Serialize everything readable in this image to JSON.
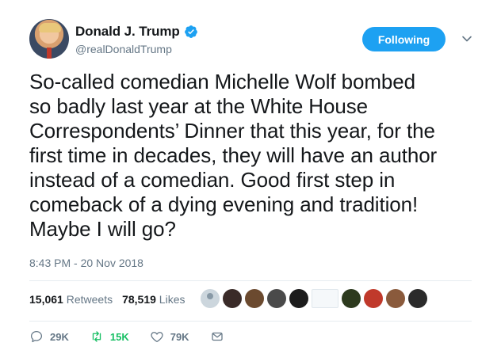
{
  "user": {
    "name": "Donald J. Trump",
    "handle": "@realDonaldTrump",
    "verified_icon": "verified-badge-icon"
  },
  "follow_button": {
    "label": "Following"
  },
  "tweet": {
    "text": "So-called comedian Michelle Wolf bombed\nso badly last year at the White House\nCorrespondents’ Dinner that this year, for the\nfirst time in decades, they will have an author\ninstead of a comedian. Good first step in\ncomeback of a dying evening and tradition!\nMaybe I will go?",
    "timestamp": "8:43 PM - 20 Nov 2018"
  },
  "stats": {
    "retweets_count": "15,061",
    "retweets_label": "Retweets",
    "likes_count": "78,519",
    "likes_label": "Likes"
  },
  "liked_by_faces": [
    {
      "color": "#ccd6dd"
    },
    {
      "color": "#3a2b28"
    },
    {
      "color": "#6b4a2f"
    },
    {
      "color": "#4a4a4a"
    },
    {
      "color": "#1c1c1c"
    },
    {
      "color": "#f5f8fa"
    },
    {
      "color": "#2d3a1e"
    },
    {
      "color": "#c0392b"
    },
    {
      "color": "#8a5a3c"
    },
    {
      "color": "#2b2b2b"
    }
  ],
  "actions": {
    "replies": "29K",
    "retweets": "15K",
    "likes": "79K"
  },
  "colors": {
    "accent": "#1da1f2",
    "retweet_green": "#17bf63",
    "muted": "#657786",
    "text": "#14171a"
  }
}
